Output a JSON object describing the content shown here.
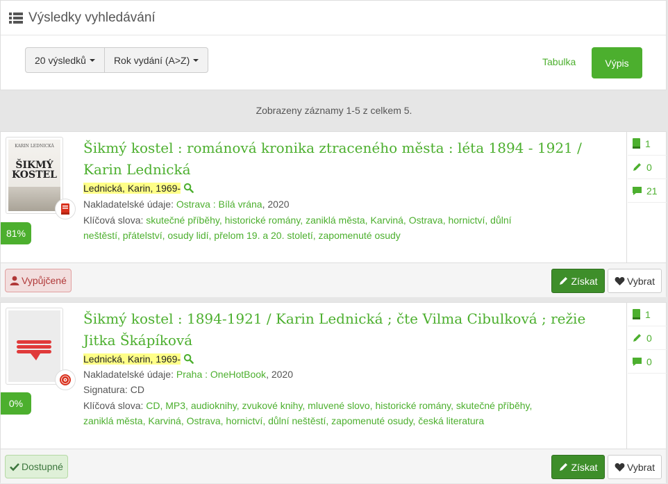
{
  "header": {
    "title": "Výsledky vyhledávání"
  },
  "toolbar": {
    "per_page_label": "20 výsledků",
    "sort_label": "Rok vydání (A>Z)",
    "table_view_label": "Tabulka",
    "list_view_label": "Výpis"
  },
  "summary": "Zobrazeny záznamy 1-5 z celkem 5.",
  "records": [
    {
      "cover_author": "KARIN LEDNICKÁ",
      "cover_title_1": "ŠIKMÝ",
      "cover_title_2": "KOSTEL",
      "type_icon": "book-icon",
      "score": "81%",
      "title": "Šikmý kostel : románová kronika ztraceného města : léta 1894 - 1921 / Karin Lednická",
      "author": "Lednická, Karin, 1969-",
      "publisher_label": "Nakladatelské údaje:",
      "publisher_place_name": "Ostrava : Bílá vrána",
      "publisher_year": ", 2020",
      "keywords_label": "Klíčová slova:",
      "keywords_line1": "skutečné příběhy, historické romány, zaniklá města, Karviná, Ostrava, hornictví, důlní",
      "keywords_line2": "neštěstí, přátelství, osudy lidí, přelom 19. a 20. století, zapomenuté osudy",
      "stats": {
        "copies": "1",
        "reviews": "0",
        "comments": "21"
      },
      "availability": "Vypůjčené",
      "get_label": "Získat",
      "pick_label": "Vybrat"
    },
    {
      "type_icon": "cd-icon",
      "score": "0%",
      "title": "Šikmý kostel : 1894-1921 / Karin Lednická ; čte Vilma Cibulková ; režie Jitka Škápíková",
      "author": "Lednická, Karin, 1969-",
      "publisher_label": "Nakladatelské údaje:",
      "publisher_place_name": "Praha : OneHotBook",
      "publisher_year": ", 2020",
      "signature": "Signatura: CD",
      "keywords_label": "Klíčová slova:",
      "keywords_line1": "CD, MP3, audioknihy, zvukové knihy, mluvené slovo, historické romány, skutečné příběhy,",
      "keywords_line2": "zaniklá města, Karviná, Ostrava, hornictví, důlní neštěstí, zapomenuté osudy, česká literatura",
      "stats": {
        "copies": "1",
        "reviews": "0",
        "comments": "0"
      },
      "availability": "Dostupné",
      "get_label": "Získat",
      "pick_label": "Vybrat"
    }
  ],
  "colors": {
    "accent": "#4caf2e",
    "highlight": "#ffff88",
    "borrowed": "#b03838"
  }
}
